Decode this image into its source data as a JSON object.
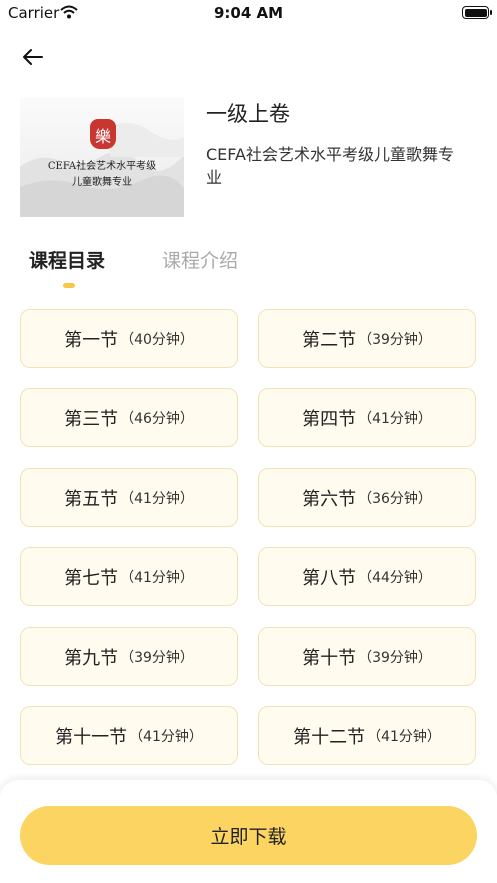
{
  "status_bar": {
    "carrier": "Carrier",
    "time": "9:04 AM"
  },
  "header": {
    "back_icon": "arrow-left-icon"
  },
  "course": {
    "cover_text_line1": "CEFA社会艺术水平考级",
    "cover_text_line2": "儿童歌舞专业",
    "title": "一级上卷",
    "subtitle": "CEFA社会艺术水平考级儿童歌舞专业"
  },
  "tabs": [
    {
      "label": "课程目录",
      "active": true
    },
    {
      "label": "课程介绍",
      "active": false
    }
  ],
  "lessons": [
    {
      "name": "第一节",
      "duration": "（40分钟）"
    },
    {
      "name": "第二节",
      "duration": "（39分钟）"
    },
    {
      "name": "第三节",
      "duration": "（46分钟）"
    },
    {
      "name": "第四节",
      "duration": "（41分钟）"
    },
    {
      "name": "第五节",
      "duration": "（41分钟）"
    },
    {
      "name": "第六节",
      "duration": "（36分钟）"
    },
    {
      "name": "第七节",
      "duration": "（41分钟）"
    },
    {
      "name": "第八节",
      "duration": "（44分钟）"
    },
    {
      "name": "第九节",
      "duration": "（39分钟）"
    },
    {
      "name": "第十节",
      "duration": "（39分钟）"
    },
    {
      "name": "第十一节",
      "duration": "（41分钟）"
    },
    {
      "name": "第十二节",
      "duration": "（41分钟）"
    }
  ],
  "actions": {
    "download_label": "立即下载"
  },
  "colors": {
    "accent": "#fcd462",
    "card_bg": "#fffbef",
    "card_border": "#f3e2b3",
    "seal": "#c8362f"
  }
}
